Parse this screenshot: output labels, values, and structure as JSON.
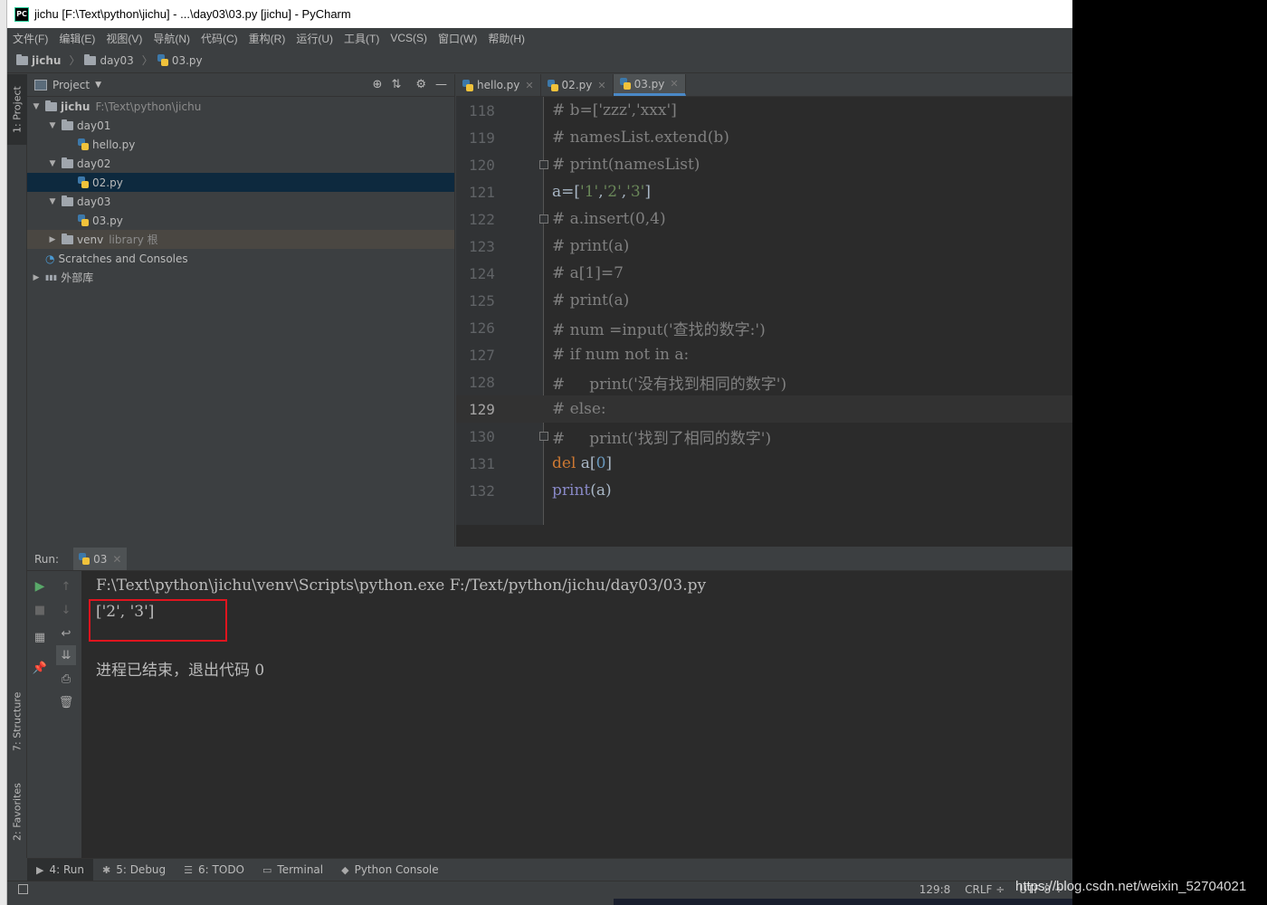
{
  "window": {
    "title": "jichu [F:\\Text\\python\\jichu] - ...\\day03\\03.py [jichu] - PyCharm",
    "logo": "PC"
  },
  "menu": [
    "文件(F)",
    "编辑(E)",
    "视图(V)",
    "导航(N)",
    "代码(C)",
    "重构(R)",
    "运行(U)",
    "工具(T)",
    "VCS(S)",
    "窗口(W)",
    "帮助(H)"
  ],
  "breadcrumb": [
    "jichu",
    "day03",
    "03.py"
  ],
  "side_tabs": {
    "project": "1: Project",
    "structure": "7: Structure",
    "favorites": "2: Favorites"
  },
  "project_panel": {
    "title": "Project",
    "tree": [
      {
        "label": "jichu",
        "sub": "F:\\Text\\python\\jichu",
        "indent": 0,
        "type": "folder",
        "expanded": true
      },
      {
        "label": "day01",
        "indent": 1,
        "type": "folder",
        "expanded": true
      },
      {
        "label": "hello.py",
        "indent": 2,
        "type": "py"
      },
      {
        "label": "day02",
        "indent": 1,
        "type": "folder",
        "expanded": true
      },
      {
        "label": "02.py",
        "indent": 2,
        "type": "py",
        "selected": true
      },
      {
        "label": "day03",
        "indent": 1,
        "type": "folder",
        "expanded": true
      },
      {
        "label": "03.py",
        "indent": 2,
        "type": "py"
      },
      {
        "label": "venv",
        "sub": "library 根",
        "indent": 1,
        "type": "folder",
        "expanded": false,
        "highlight": true
      },
      {
        "label": "Scratches and Consoles",
        "indent": 0,
        "type": "scratch"
      },
      {
        "label": "外部库",
        "indent": 0,
        "type": "lib",
        "expanded": false
      }
    ]
  },
  "editor": {
    "tabs": [
      {
        "label": "hello.py",
        "active": false
      },
      {
        "label": "02.py",
        "active": false
      },
      {
        "label": "03.py",
        "active": true
      }
    ],
    "current_line": 129,
    "lines": [
      {
        "n": "118",
        "text": "# b=['zzz','xxx']",
        "kind": "comment"
      },
      {
        "n": "119",
        "text": "# namesList.extend(b)",
        "kind": "comment"
      },
      {
        "n": "120",
        "text": "# print(namesList)",
        "kind": "comment",
        "fold": true
      },
      {
        "n": "121",
        "text": "a=['1','2','3']",
        "kind": "code-a"
      },
      {
        "n": "122",
        "text": "# a.insert(0,4)",
        "kind": "comment",
        "fold": true
      },
      {
        "n": "123",
        "text": "# print(a)",
        "kind": "comment"
      },
      {
        "n": "124",
        "text": "# a[1]=7",
        "kind": "comment"
      },
      {
        "n": "125",
        "text": "# print(a)",
        "kind": "comment"
      },
      {
        "n": "126",
        "text": "# num =input('查找的数字:')",
        "kind": "comment"
      },
      {
        "n": "127",
        "text": "# if num not in a:",
        "kind": "comment"
      },
      {
        "n": "128",
        "text": "#     print('没有找到相同的数字')",
        "kind": "comment"
      },
      {
        "n": "129",
        "text": "# else:",
        "kind": "comment"
      },
      {
        "n": "130",
        "text": "#     print('找到了相同的数字')",
        "kind": "comment",
        "fold": true
      },
      {
        "n": "131",
        "text": "del a[0]",
        "kind": "code-del"
      },
      {
        "n": "132",
        "text": "print(a)",
        "kind": "code-print"
      }
    ]
  },
  "run_panel": {
    "label": "Run:",
    "tab": "03",
    "output": [
      "F:\\Text\\python\\jichu\\venv\\Scripts\\python.exe F:/Text/python/jichu/day03/03.py",
      "['2', '3']",
      "进程已结束，退出代码 0"
    ]
  },
  "bottom_tabs": [
    {
      "label": "4: Run",
      "icon": "play-icon",
      "active": true
    },
    {
      "label": "5: Debug",
      "icon": "bug-icon"
    },
    {
      "label": "6: TODO",
      "icon": "list-icon"
    },
    {
      "label": "Terminal",
      "icon": "terminal-icon"
    },
    {
      "label": "Python Console",
      "icon": "python-icon"
    }
  ],
  "status": {
    "position": "129:8",
    "line_sep": "CRLF ÷",
    "encoding": "UTF-8 ÷"
  },
  "watermark": "https://blog.csdn.net/weixin_52704021",
  "colors": {
    "comment": "#808080",
    "keyword": "#cc7832",
    "string": "#6a8759",
    "builtin": "#8888c6",
    "highlight_box": "#e0141e",
    "selection": "#0d293e"
  }
}
